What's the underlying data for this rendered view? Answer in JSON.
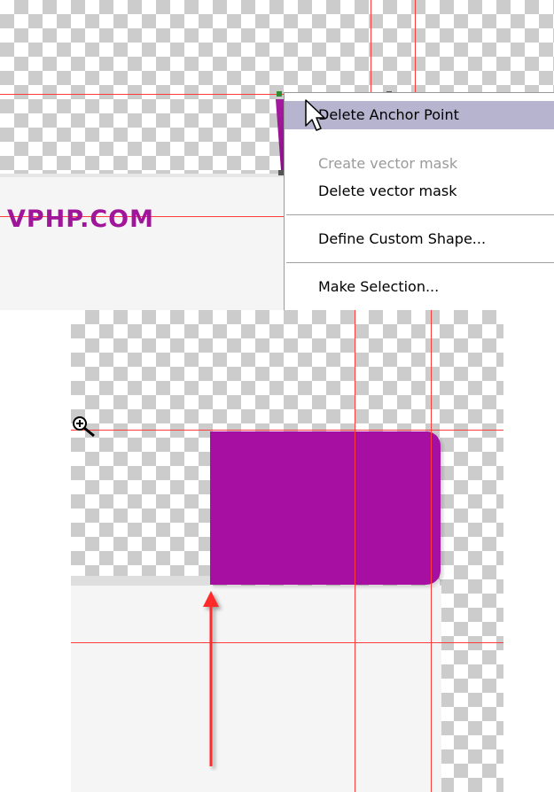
{
  "brand": {
    "text": "VPHP.COM",
    "color": "#a0169a"
  },
  "context_menu": {
    "items": [
      {
        "label": "Delete Anchor Point",
        "state": "hover"
      },
      {
        "label": "Create vector mask",
        "state": "disabled"
      },
      {
        "label": "Delete vector mask",
        "state": "normal"
      },
      {
        "label": "Define Custom Shape...",
        "state": "normal"
      },
      {
        "label": "Make Selection...",
        "state": "normal"
      }
    ]
  },
  "icons": {
    "cursor": "arrow-pointer-icon",
    "zoom": "zoom-in-icon",
    "arrow": "red-up-arrow"
  },
  "colors": {
    "guide": "#ff3b3b",
    "shape_fill": "#a70ea2",
    "menu_highlight": "#b6b4cf",
    "annotation_arrow": "#ff2a2a"
  }
}
